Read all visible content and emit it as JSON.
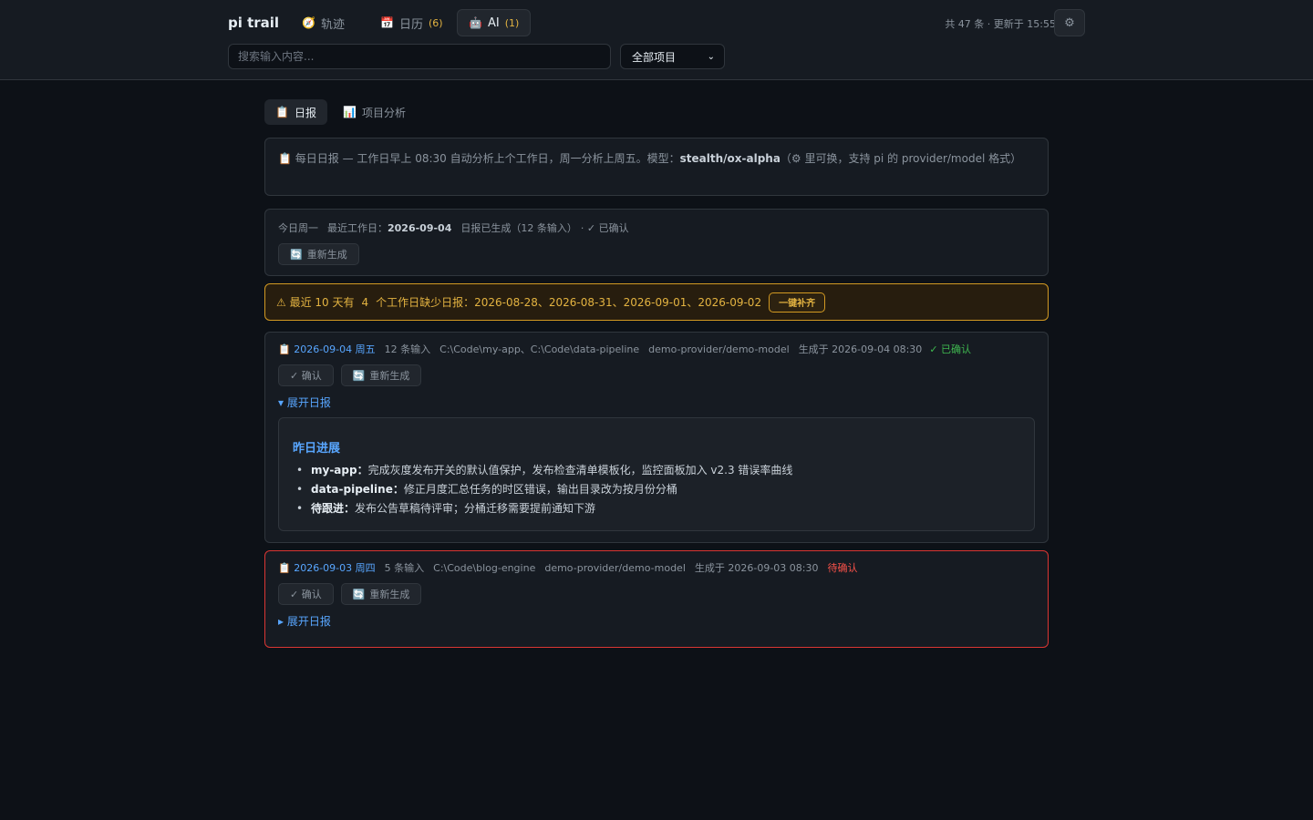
{
  "app": {
    "title": "pi trail"
  },
  "nav": {
    "tabs": [
      {
        "label": "轨迹",
        "count": "",
        "icon": "compass-icon"
      },
      {
        "label": "日历",
        "count": "(6)",
        "icon": "calendar-icon"
      },
      {
        "label": "AI",
        "count": "(1)",
        "icon": "robot-icon"
      }
    ]
  },
  "search": {
    "placeholder": "搜索输入内容..."
  },
  "filter": {
    "selected": "全部项目"
  },
  "header_status": "共 47 条 · 更新于 15:55",
  "subtabs": [
    {
      "label": "日报",
      "icon": "report-icon"
    },
    {
      "label": "项目分析",
      "icon": "bar-chart-icon"
    }
  ],
  "info": {
    "prefix": "每日日报 — 工作日早上 08:30 自动分析上个工作日，周一分析上周五。模型：",
    "model": "stealth/ox-alpha",
    "suffix": "（⚙ 里可换，支持 pi 的 provider/model 格式）"
  },
  "today": {
    "day": "今日周一",
    "latest_label": "最近工作日：",
    "latest_date": "2026-09-04",
    "generated": "日报已生成（12 条输入）",
    "confirmed": "· ✓ 已确认",
    "regenerate": "重新生成"
  },
  "warning": {
    "text_a": "⚠ 最近 10 天有",
    "count": "4",
    "text_b": "个工作日缺少日报：2026-08-28、2026-08-31、2026-09-01、2026-09-02",
    "button": "一键补齐"
  },
  "reports": [
    {
      "date": "2026-09-04 周五",
      "inputs": "12 条输入",
      "paths": "C:\\Code\\my-app、C:\\Code\\data-pipeline",
      "model": "demo-provider/demo-model",
      "generated": "生成于 2026-09-04 08:30",
      "status": "✓ 已确认",
      "confirm": "✓ 确认",
      "regenerate": "重新生成",
      "toggle": "▾ 展开日报",
      "body": {
        "heading": "昨日进展",
        "items": [
          {
            "key": "my-app：",
            "text": "完成灰度发布开关的默认值保护，发布检查清单模板化，监控面板加入 v2.3 错误率曲线"
          },
          {
            "key": "data-pipeline：",
            "text": "修正月度汇总任务的时区错误，输出目录改为按月份分桶"
          },
          {
            "key": "待跟进：",
            "text": "发布公告草稿待评审；分桶迁移需要提前通知下游"
          }
        ]
      }
    },
    {
      "date": "2026-09-03 周四",
      "inputs": "5 条输入",
      "paths": "C:\\Code\\blog-engine",
      "model": "demo-provider/demo-model",
      "generated": "生成于 2026-09-03 08:30",
      "status": "待确认",
      "confirm": "✓ 确认",
      "regenerate": "重新生成",
      "toggle": "▸ 展开日报"
    }
  ]
}
